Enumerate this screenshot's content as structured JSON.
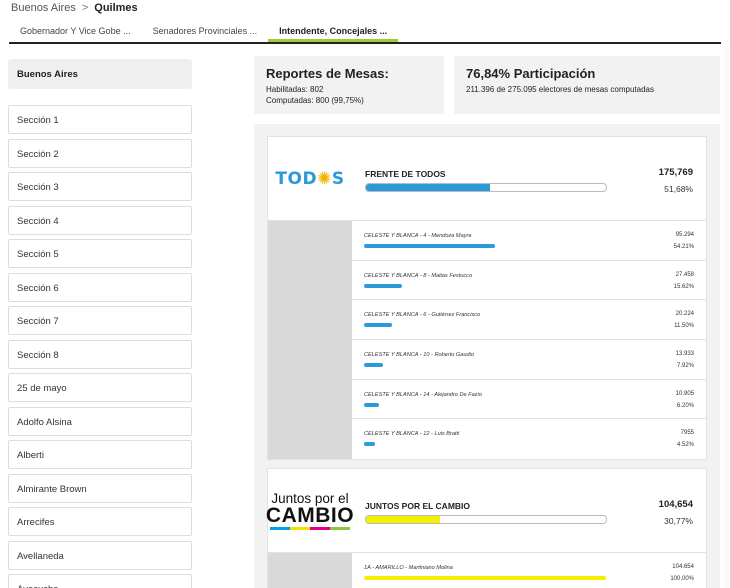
{
  "breadcrumb": {
    "root": "Buenos Aires",
    "separator": ">",
    "current": "Quilmes"
  },
  "tabs": [
    {
      "label": "Gobernador Y Vice Gobe ..."
    },
    {
      "label": "Senadores Provinciales ..."
    },
    {
      "label": "Intendente, Concejales ..."
    }
  ],
  "colors": {
    "tab_active": "#9ccc3c",
    "todos": "#2a9bd8",
    "cambio": "#f5f000"
  },
  "sidebar": {
    "header": "Buenos Aires",
    "items": [
      {
        "label": "Sección 1"
      },
      {
        "label": "Sección 2"
      },
      {
        "label": "Sección 3"
      },
      {
        "label": "Sección 4"
      },
      {
        "label": "Sección 5"
      },
      {
        "label": "Sección 6"
      },
      {
        "label": "Sección 7"
      },
      {
        "label": "Sección 8"
      },
      {
        "label": "25 de mayo"
      },
      {
        "label": "Adolfo Alsina"
      },
      {
        "label": "Alberti"
      },
      {
        "label": "Almirante Brown"
      },
      {
        "label": "Arrecifes"
      },
      {
        "label": "Avellaneda"
      },
      {
        "label": "Ayacucho"
      }
    ]
  },
  "mesas": {
    "title": "Reportes de Mesas:",
    "habilitadas": "Habilitadas: 802",
    "computadas": "Computadas: 800 (99,75%)"
  },
  "participacion": {
    "title": "76,84% Participación",
    "detail": "211.396 de 275.095 electores de mesas computadas"
  },
  "parties": [
    {
      "logo": {
        "main": "TOD",
        "sun": "✺",
        "tail": "S"
      },
      "name": "FRENTE DE TODOS",
      "votes": "175,769",
      "pct": "51,68%",
      "share": 0.5168,
      "candidates": [
        {
          "name": "CELESTE Y BLANCA - 4 - Mendoza Mayra",
          "votes": "95.294",
          "pct": "54.21%",
          "share": 0.5421
        },
        {
          "name": "CELESTE Y BLANCA - 8 - Matias Festucco",
          "votes": "27.458",
          "pct": "15.62%",
          "share": 0.1562
        },
        {
          "name": "CELESTE Y BLANCA - 6 - Gutiérrez Francisco",
          "votes": "20.224",
          "pct": "11.50%",
          "share": 0.115
        },
        {
          "name": "CELESTE Y BLANCA - 10 - Roberto Gaudio",
          "votes": "13.933",
          "pct": "7.92%",
          "share": 0.0792
        },
        {
          "name": "CELESTE Y BLANCA - 14 - Alejandro De Fazio",
          "votes": "10.905",
          "pct": "6.20%",
          "share": 0.062
        },
        {
          "name": "CELESTE Y BLANCA - 12 - Luis Bratti",
          "votes": "7955",
          "pct": "4.52%",
          "share": 0.0452
        }
      ]
    },
    {
      "logo": {
        "line1": "Juntos por el",
        "line2": "CAMBIO"
      },
      "name": "JUNTOS POR EL CAMBIO",
      "votes": "104,654",
      "pct": "30,77%",
      "share": 0.3077,
      "candidates": [
        {
          "name": "1A - AMARILLO - Martiniano Molina",
          "votes": "104.654",
          "pct": "100.00%",
          "share": 1.0
        }
      ]
    }
  ]
}
